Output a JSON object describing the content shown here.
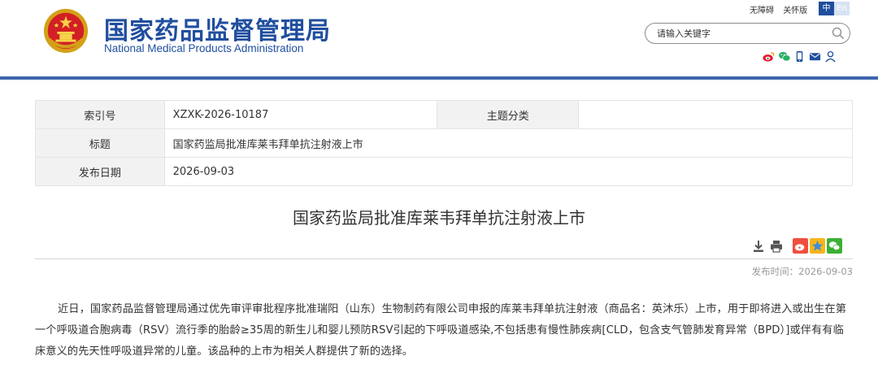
{
  "header": {
    "logo_cn": "国家药品监督管理局",
    "logo_en": "National Medical Products Administration",
    "links": [
      "无障碍",
      "关怀版"
    ],
    "lang": {
      "cn": "中",
      "en": "En"
    },
    "search_placeholder": "请输入关键字",
    "social_icons": [
      "weibo-icon",
      "wechat-icon",
      "mobile-icon",
      "mail-icon",
      "user-icon"
    ]
  },
  "meta": {
    "index_label": "索引号",
    "index_value": "XZXK-2026-10187",
    "category_label": "主题分类",
    "category_value": "",
    "title_label": "标题",
    "title_value": "国家药监局批准库莱韦拜单抗注射液上市",
    "date_label": "发布日期",
    "date_value": "2026-09-03"
  },
  "article": {
    "title": "国家药监局批准库莱韦拜单抗注射液上市",
    "publish_time": "发布时间：2026-09-03",
    "body": "近日，国家药品监督管理局通过优先审评审批程序批准瑞阳（山东）生物制药有限公司申报的库莱韦拜单抗注射液（商品名：英沐乐）上市，用于即将进入或出生在第一个呼吸道合胞病毒（RSV）流行季的胎龄≥35周的新生儿和婴儿预防RSV引起的下呼吸道感染,不包括患有慢性肺疾病[CLD，包含支气管肺发育异常（BPD）]或伴有有临床意义的先天性呼吸道异常的儿童。该品种的上市为相关人群提供了新的选择。"
  },
  "colors": {
    "brand": "#1f4e9e",
    "bar": "#3e64ad",
    "weibo": "#e6162d",
    "wechat": "#2aae67"
  }
}
